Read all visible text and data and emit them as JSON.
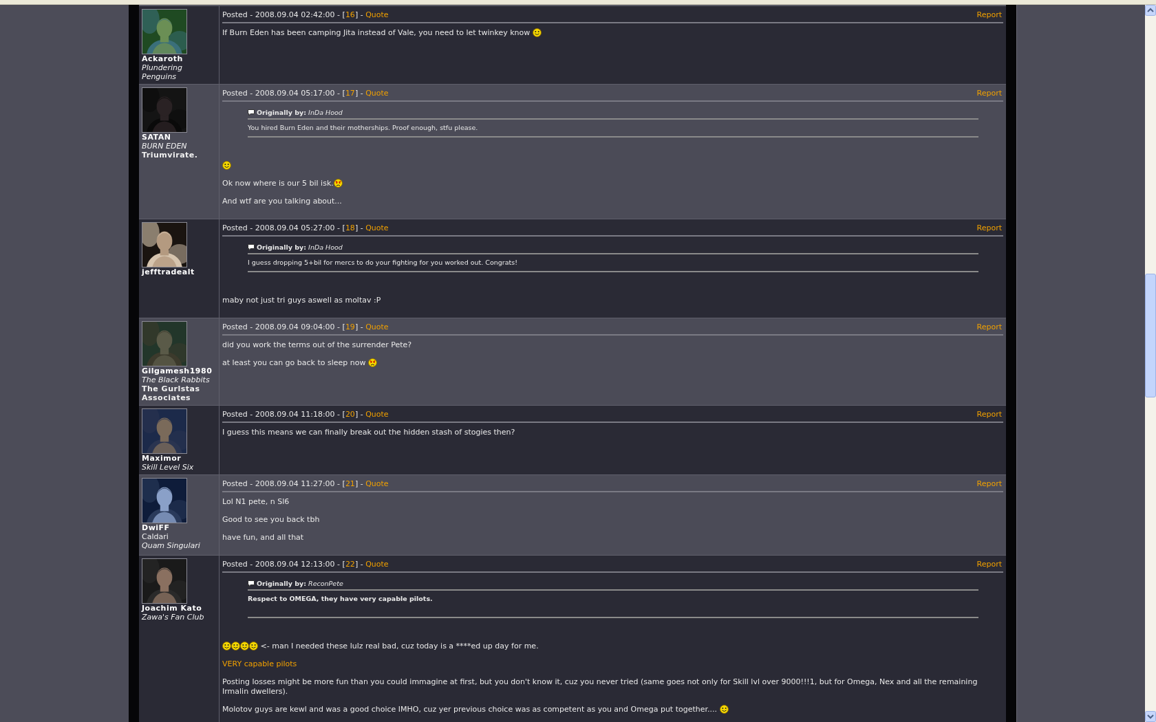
{
  "posts": [
    {
      "author": {
        "name": "Ackaroth",
        "lines": [
          {
            "text": "Plundering Penguins",
            "kind": "corporation"
          }
        ]
      },
      "header": {
        "prefix": "Posted - 2008.09.04 02:42:00 - [",
        "number": "16",
        "separator": "] - ",
        "quote": "Quote",
        "report": "Report"
      },
      "body": [
        [
          {
            "kind": "text",
            "text": "If Burn Eden has been camping Jita instead of Vale, you need to let twinkey know "
          },
          {
            "kind": "smiley"
          }
        ]
      ]
    },
    {
      "author": {
        "name": "SATAN",
        "lines": [
          {
            "text": "BURN EDEN",
            "kind": "corporation"
          },
          {
            "text": "Triumvirate.",
            "kind": "alliance"
          }
        ]
      },
      "header": {
        "prefix": "Posted - 2008.09.04 05:17:00 - [",
        "number": "17",
        "separator": "] - ",
        "quote": "Quote",
        "report": "Report"
      },
      "quote": {
        "label": "Originally by:",
        "author": "InDa Hood",
        "text": "You hired Burn Eden and their motherships. Proof enough, stfu please.",
        "bold": false
      },
      "body": [
        [
          {
            "kind": "smiley"
          }
        ],
        [
          {
            "kind": "text",
            "text": "Ok now where is our 5 bil isk."
          },
          {
            "kind": "angry"
          }
        ],
        [
          {
            "kind": "text",
            "text": "And wtf are you talking about..."
          }
        ]
      ]
    },
    {
      "author": {
        "name": "jefftradealt"
      },
      "header": {
        "prefix": "Posted - 2008.09.04 05:27:00 - [",
        "number": "18",
        "separator": "] - ",
        "quote": "Quote",
        "report": "Report"
      },
      "quote": {
        "label": "Originally by:",
        "author": "InDa Hood",
        "text": "I guess dropping 5+bil for mercs to do your fighting for you worked out. Congrats!",
        "bold": false
      },
      "body": [
        [
          {
            "kind": "text",
            "text": "maby not just tri guys aswell as moltav :P"
          }
        ]
      ]
    },
    {
      "author": {
        "name": "Gilgamesh1980",
        "lines": [
          {
            "text": "The Black Rabbits",
            "kind": "corporation"
          },
          {
            "text": "The Gurlstas Associates",
            "kind": "alliance"
          }
        ]
      },
      "header": {
        "prefix": "Posted - 2008.09.04 09:04:00 - [",
        "number": "19",
        "separator": "] - ",
        "quote": "Quote",
        "report": "Report"
      },
      "body": [
        [
          {
            "kind": "text",
            "text": "did you work the terms out of the surrender Pete?"
          }
        ],
        [
          {
            "kind": "text",
            "text": "at least you can go back to sleep now "
          },
          {
            "kind": "angry"
          }
        ]
      ]
    },
    {
      "author": {
        "name": "Maximor",
        "lines": [
          {
            "text": "Skill Level Six",
            "kind": "corporation"
          }
        ]
      },
      "header": {
        "prefix": "Posted - 2008.09.04 11:18:00 - [",
        "number": "20",
        "separator": "] - ",
        "quote": "Quote",
        "report": "Report"
      },
      "body": [
        [
          {
            "kind": "text",
            "text": "I guess this means we can finally break out the hidden stash of stogies then?"
          }
        ]
      ]
    },
    {
      "author": {
        "name": "DwiFF",
        "lines": [
          {
            "text": "Caldari",
            "kind": "race"
          },
          {
            "text": "Quam Singulari",
            "kind": "corporation"
          }
        ]
      },
      "header": {
        "prefix": "Posted - 2008.09.04 11:27:00 - [",
        "number": "21",
        "separator": "] - ",
        "quote": "Quote",
        "report": "Report"
      },
      "body": [
        [
          {
            "kind": "text",
            "text": "Lol N1 pete, n Sl6"
          }
        ],
        [
          {
            "kind": "text",
            "text": "Good to see you back tbh"
          }
        ],
        [
          {
            "kind": "text",
            "text": "have fun, and all that"
          }
        ]
      ]
    },
    {
      "author": {
        "name": "Joachim Kato",
        "lines": [
          {
            "text": "Zawa's Fan Club",
            "kind": "corporation"
          }
        ]
      },
      "header": {
        "prefix": "Posted - 2008.09.04 12:13:00 - [",
        "number": "22",
        "separator": "] - ",
        "quote": "Quote",
        "report": "Report"
      },
      "quote": {
        "label": "Originally by:",
        "author": "ReconPete",
        "text": "Respect to OMEGA, they have very capable pilots.",
        "bold": true
      },
      "body": [
        [
          {
            "kind": "smiley"
          },
          {
            "kind": "smiley"
          },
          {
            "kind": "smiley"
          },
          {
            "kind": "smiley"
          },
          {
            "kind": "text",
            "text": " <- man I needed these lulz real bad, cuz today is a ****ed up day for me."
          }
        ],
        [
          {
            "kind": "link",
            "text": "VERY capable pilots"
          }
        ],
        [
          {
            "kind": "text",
            "text": "Posting losses might be more fun than you could immagine at first, but you don't know it, cuz you never tried (same goes not only for Skill lvl over 9000!!!1, but for Omega, Nex and all the remaining Irmalin dwellers)."
          }
        ],
        [
          {
            "kind": "text",
            "text": "Molotov guys are kewl and was a good choice IMHO, cuz yer previous choice was as competent as you and Omega put together.... "
          },
          {
            "kind": "smiley"
          }
        ]
      ]
    }
  ]
}
